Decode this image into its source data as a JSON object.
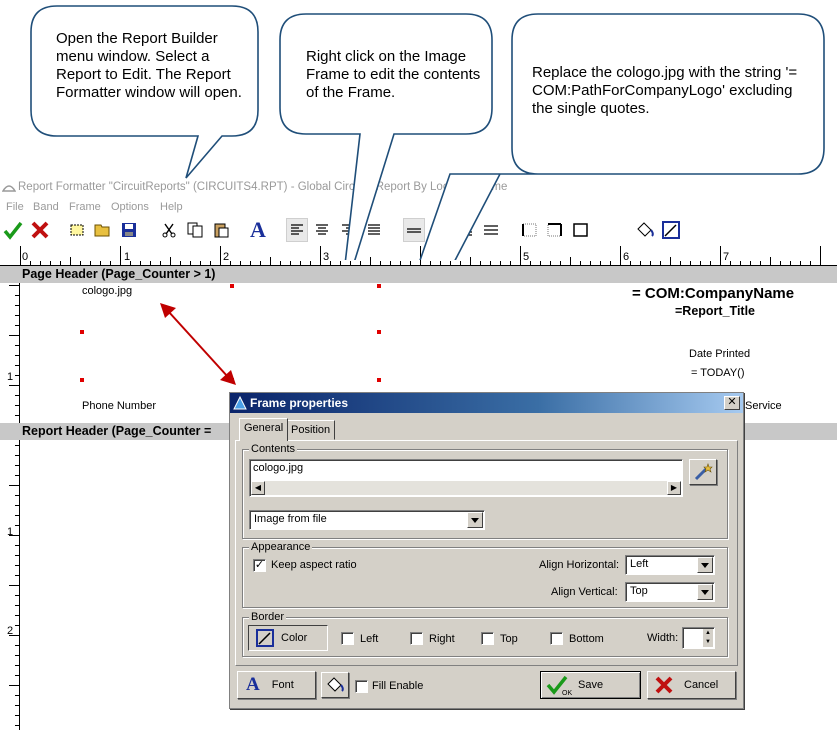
{
  "callouts": [
    {
      "text": "Open the Report Builder menu window. Select a Report to Edit. The Report Formatter window will open."
    },
    {
      "text": "Right click on the Image Frame to edit the contents of the Frame."
    },
    {
      "text": "Replace the cologo.jpg with the string '= COM:PathForCompanyLogo' excluding the single quotes."
    }
  ],
  "window": {
    "title": "Report Formatter \"CircuitReports\" (CIRCUITS4.RPT) - Global Circuits Report By Location Name"
  },
  "menu": [
    "File",
    "Band",
    "Frame",
    "Options",
    "Help"
  ],
  "toolbar": {
    "icons": [
      "check-icon",
      "x-icon",
      "new-frame-icon",
      "open-folder-icon",
      "save-icon",
      "cut-icon",
      "copy-icon",
      "paste-icon",
      "font-icon",
      "align-left-icon",
      "align-center-icon",
      "align-right-icon",
      "justify-icon",
      "line-top-icon",
      "line-middle-icon",
      "line-bottom-icon",
      "line-multi-icon",
      "frame-left-icon",
      "frame-right-icon",
      "frame-border-icon",
      "fill-bucket-icon",
      "border-color-icon"
    ]
  },
  "ruler": {
    "labels": [
      "0",
      "1",
      "2",
      "3",
      "4",
      "5",
      "6",
      "7"
    ],
    "vlabels": [
      "1",
      "1",
      "2"
    ]
  },
  "bands": {
    "page_header": "Page Header (Page_Counter > 1)",
    "report_header": "Report Header (Page_Counter ="
  },
  "design": {
    "image_frame_text": "cologo.jpg",
    "company_name": "= COM:CompanyName",
    "report_title": "=Report_Title",
    "date_printed": "Date Printed",
    "today": "= TODAY()",
    "phone_number": "Phone Number",
    "service": "Service"
  },
  "dialog": {
    "title": "Frame properties",
    "close": "✕",
    "tabs": [
      "General",
      "Position"
    ],
    "contents_label": "Contents",
    "contents_value": "cologo.jpg",
    "source_type": "Image from file",
    "appearance_label": "Appearance",
    "keep_aspect_label": "Keep aspect ratio",
    "keep_aspect_checked": true,
    "align_h_label": "Align Horizontal:",
    "align_h_value": "Left",
    "align_v_label": "Align Vertical:",
    "align_v_value": "Top",
    "border_label": "Border",
    "color_button": "Color",
    "border_left": "Left",
    "border_right": "Right",
    "border_top": "Top",
    "border_bottom": "Bottom",
    "width_label": "Width:",
    "font_button": "Font",
    "fill_enable": "Fill Enable",
    "save_button": "Save",
    "cancel_button": "Cancel",
    "ok_badge": "OK"
  },
  "colors": {
    "callout_border": "#1f4e79",
    "arrow": "#c00000",
    "title_gradient_start": "#0a246a",
    "dialog_bg": "#d4d0c8",
    "band_bg": "#c8c8c8"
  }
}
